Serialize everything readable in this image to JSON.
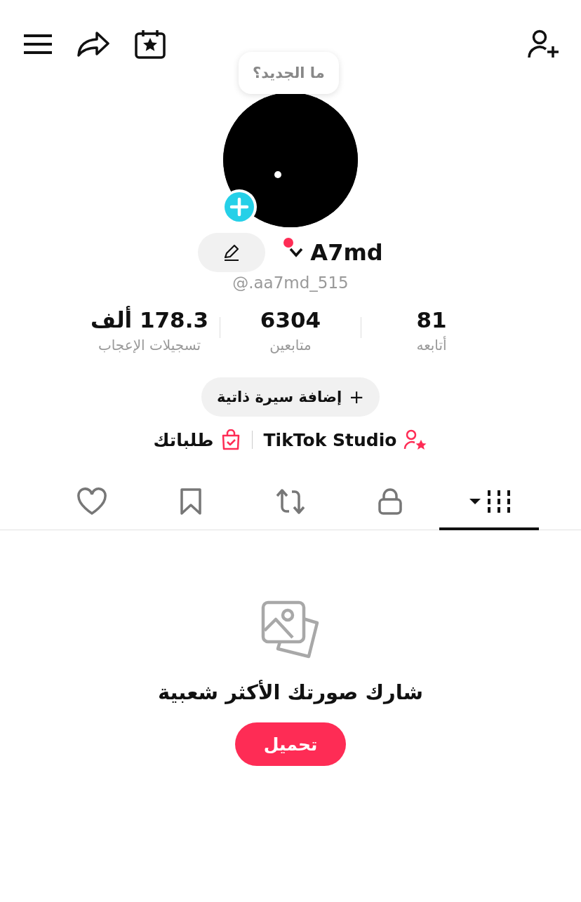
{
  "bubble": {
    "text": "ما الجديد؟"
  },
  "profile": {
    "name": "A7md",
    "handle": "@.aa7md_515",
    "notification_dot": true
  },
  "stats": [
    {
      "value": "81",
      "label": "أتابعه"
    },
    {
      "value": "6304",
      "label": "متابعين"
    },
    {
      "value": "178.3 ألف",
      "label": "تسجيلات الإعجاب"
    }
  ],
  "bio_button": {
    "icon": "+",
    "label": "إضافة سيرة ذاتية"
  },
  "links": [
    {
      "kind": "studio",
      "label": "TikTok Studio"
    },
    {
      "kind": "orders",
      "label": "طلباتك"
    }
  ],
  "tabs": [
    {
      "kind": "grid",
      "selected": true
    },
    {
      "kind": "private",
      "selected": false
    },
    {
      "kind": "repost",
      "selected": false
    },
    {
      "kind": "saved",
      "selected": false
    },
    {
      "kind": "liked",
      "selected": false
    }
  ],
  "empty_state": {
    "message": "شارك صورتك الأكثر شعبية",
    "button": "تحميل"
  }
}
